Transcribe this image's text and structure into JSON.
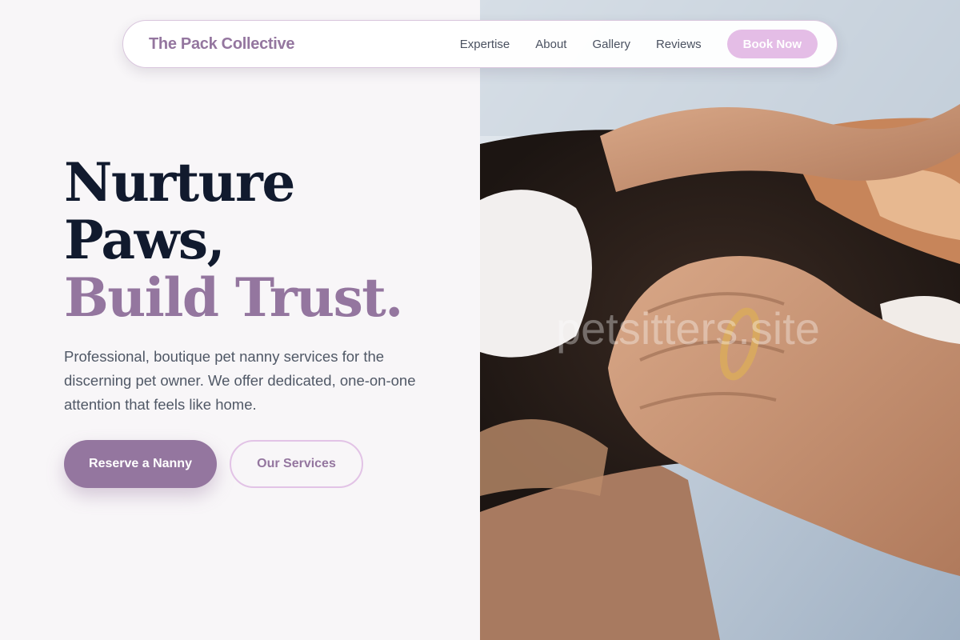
{
  "nav": {
    "brand": "The Pack Collective",
    "links": [
      "Expertise",
      "About",
      "Gallery",
      "Reviews"
    ],
    "cta": "Book Now"
  },
  "hero": {
    "headline_line1": "Nurture",
    "headline_line2": "Paws,",
    "headline_accent": "Build Trust.",
    "subtext": "Professional, boutique pet nanny services for the discerning pet owner. We offer dedicated, one-on-one attention that feels like home.",
    "primary_button": "Reserve a Nanny",
    "secondary_button": "Our Services"
  },
  "photo": {
    "watermark": "petsitters.site",
    "subject": "hands-holding-calico-cat-photo"
  },
  "colors": {
    "accent": "#94769f",
    "cta_pink": "#e4bde6",
    "headline_dark": "#111a2e",
    "background": "#f8f6f8"
  }
}
